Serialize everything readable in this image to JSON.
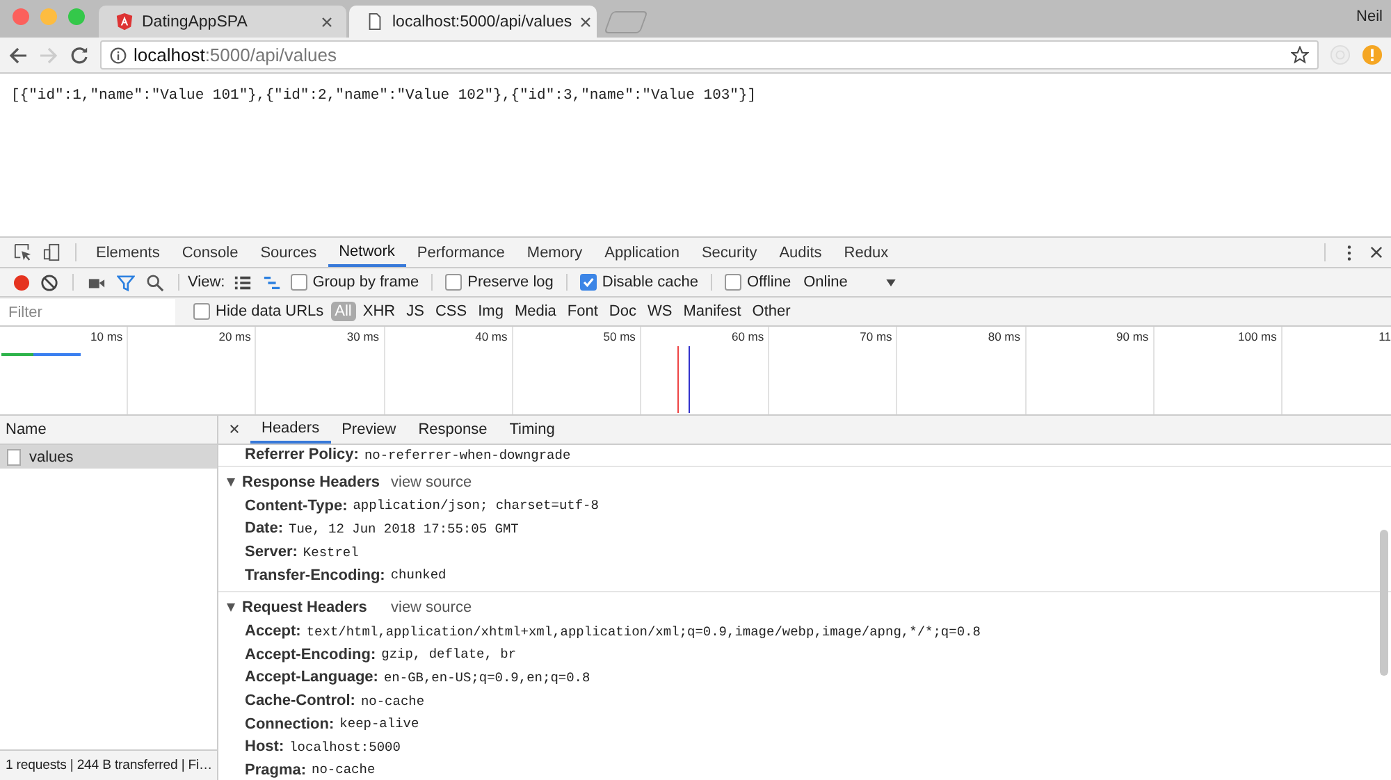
{
  "window": {
    "tabs": [
      {
        "title": "DatingAppSPA",
        "kind": "app",
        "selected": false
      },
      {
        "title": "localhost:5000/api/values",
        "kind": "page",
        "selected": true
      }
    ],
    "user": "Neil"
  },
  "address_bar": {
    "host": "localhost",
    "path": ":5000/api/values"
  },
  "page_body": "[{\"id\":1,\"name\":\"Value 101\"},{\"id\":2,\"name\":\"Value 102\"},{\"id\":3,\"name\":\"Value 103\"}]",
  "devtools": {
    "tabs": [
      {
        "label": "Elements",
        "selected": false
      },
      {
        "label": "Console",
        "selected": false
      },
      {
        "label": "Sources",
        "selected": false
      },
      {
        "label": "Network",
        "selected": true
      },
      {
        "label": "Performance",
        "selected": false
      },
      {
        "label": "Memory",
        "selected": false
      },
      {
        "label": "Application",
        "selected": false
      },
      {
        "label": "Security",
        "selected": false
      },
      {
        "label": "Audits",
        "selected": false
      },
      {
        "label": "Redux",
        "selected": false
      }
    ],
    "toolbar": {
      "view_label": "View:",
      "checkboxes": [
        {
          "label": "Group by frame",
          "checked": false
        },
        {
          "label": "Preserve log",
          "checked": false
        },
        {
          "label": "Disable cache",
          "checked": true
        },
        {
          "label": "Offline",
          "checked": false
        }
      ],
      "throttle": "Online"
    },
    "filter": {
      "placeholder": "Filter",
      "hide_data_urls": {
        "label": "Hide data URLs",
        "checked": false
      },
      "types": [
        {
          "label": "All",
          "selected": true
        },
        {
          "label": "XHR",
          "selected": false
        },
        {
          "label": "JS",
          "selected": false
        },
        {
          "label": "CSS",
          "selected": false
        },
        {
          "label": "Img",
          "selected": false
        },
        {
          "label": "Media",
          "selected": false
        },
        {
          "label": "Font",
          "selected": false
        },
        {
          "label": "Doc",
          "selected": false
        },
        {
          "label": "WS",
          "selected": false
        },
        {
          "label": "Manifest",
          "selected": false
        },
        {
          "label": "Other",
          "selected": false
        }
      ]
    },
    "timeline": {
      "ticks": [
        "10 ms",
        "20 ms",
        "30 ms",
        "40 ms",
        "50 ms",
        "60 ms",
        "70 ms",
        "80 ms",
        "90 ms",
        "100 ms",
        "11"
      ]
    },
    "requests": {
      "column": "Name",
      "rows": [
        {
          "name": "values",
          "selected": true
        }
      ],
      "status": "1 requests | 244 B transferred | Fi…"
    },
    "detail": {
      "tabs": [
        {
          "label": "Headers",
          "selected": true
        },
        {
          "label": "Preview",
          "selected": false
        },
        {
          "label": "Response",
          "selected": false
        },
        {
          "label": "Timing",
          "selected": false
        }
      ],
      "referrer": {
        "name": "Referrer Policy:",
        "value": "no-referrer-when-downgrade"
      },
      "sections": [
        {
          "title": "Response Headers",
          "link": "view source",
          "expanded": true,
          "headers": [
            {
              "name": "Content-Type:",
              "value": "application/json; charset=utf-8"
            },
            {
              "name": "Date:",
              "value": "Tue, 12 Jun 2018 17:55:05 GMT"
            },
            {
              "name": "Server:",
              "value": "Kestrel"
            },
            {
              "name": "Transfer-Encoding:",
              "value": "chunked"
            }
          ]
        },
        {
          "title": "Request Headers",
          "link": "view source",
          "expanded": true,
          "headers": [
            {
              "name": "Accept:",
              "value": "text/html,application/xhtml+xml,application/xml;q=0.9,image/webp,image/apng,*/*;q=0.8"
            },
            {
              "name": "Accept-Encoding:",
              "value": "gzip, deflate, br"
            },
            {
              "name": "Accept-Language:",
              "value": "en-GB,en-US;q=0.9,en;q=0.8"
            },
            {
              "name": "Cache-Control:",
              "value": "no-cache"
            },
            {
              "name": "Connection:",
              "value": "keep-alive"
            },
            {
              "name": "Host:",
              "value": "localhost:5000"
            },
            {
              "name": "Pragma:",
              "value": "no-cache"
            }
          ]
        }
      ]
    }
  }
}
